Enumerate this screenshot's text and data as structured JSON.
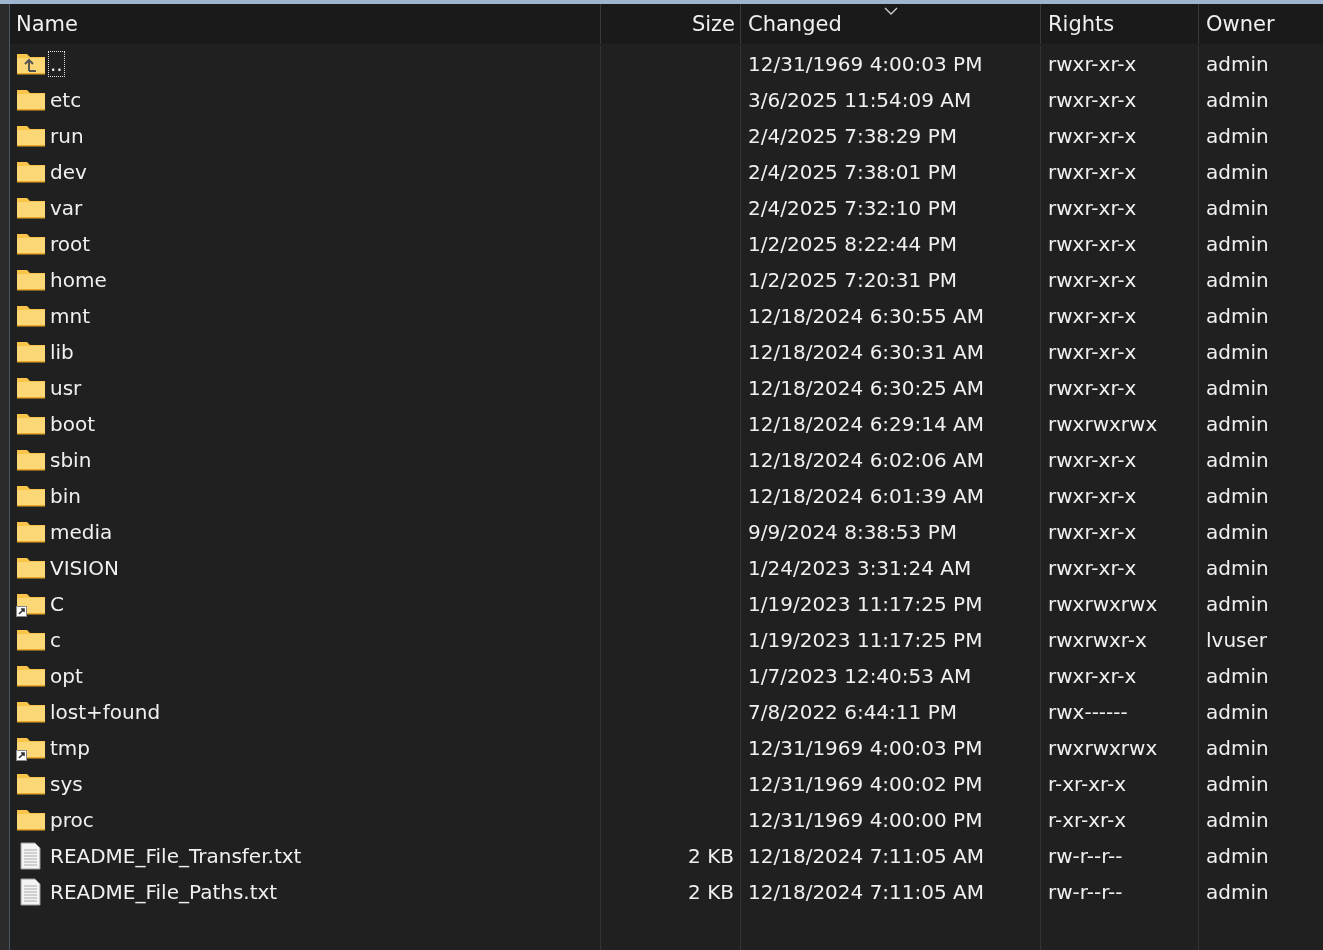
{
  "columns": [
    {
      "label": "Name",
      "sorted": false
    },
    {
      "label": "Size",
      "sorted": false
    },
    {
      "label": "Changed",
      "sorted": true
    },
    {
      "label": "Rights",
      "sorted": false
    },
    {
      "label": "Owner",
      "sorted": false
    }
  ],
  "rows": [
    {
      "kind": "up",
      "name": "..",
      "size": "",
      "changed": "12/31/1969 4:00:03 PM",
      "rights": "rwxr-xr-x",
      "owner": "admin",
      "focused": true
    },
    {
      "kind": "folder",
      "name": "etc",
      "changed": "3/6/2025 11:54:09 AM",
      "rights": "rwxr-xr-x",
      "owner": "admin",
      "focused": false
    },
    {
      "kind": "folder",
      "name": "run",
      "changed": "2/4/2025 7:38:29 PM",
      "rights": "rwxr-xr-x",
      "owner": "admin",
      "focused": false
    },
    {
      "kind": "folder",
      "name": "dev",
      "changed": "2/4/2025 7:38:01 PM",
      "rights": "rwxr-xr-x",
      "owner": "admin",
      "focused": false
    },
    {
      "kind": "folder",
      "name": "var",
      "changed": "2/4/2025 7:32:10 PM",
      "rights": "rwxr-xr-x",
      "owner": "admin",
      "focused": false
    },
    {
      "kind": "folder",
      "name": "root",
      "changed": "1/2/2025 8:22:44 PM",
      "rights": "rwxr-xr-x",
      "owner": "admin",
      "focused": false
    },
    {
      "kind": "folder",
      "name": "home",
      "changed": "1/2/2025 7:20:31 PM",
      "rights": "rwxr-xr-x",
      "owner": "admin",
      "focused": false
    },
    {
      "kind": "folder",
      "name": "mnt",
      "changed": "12/18/2024 6:30:55 AM",
      "rights": "rwxr-xr-x",
      "owner": "admin",
      "focused": false
    },
    {
      "kind": "folder",
      "name": "lib",
      "changed": "12/18/2024 6:30:31 AM",
      "rights": "rwxr-xr-x",
      "owner": "admin",
      "focused": false
    },
    {
      "kind": "folder",
      "name": "usr",
      "changed": "12/18/2024 6:30:25 AM",
      "rights": "rwxr-xr-x",
      "owner": "admin",
      "focused": false
    },
    {
      "kind": "folder",
      "name": "boot",
      "changed": "12/18/2024 6:29:14 AM",
      "rights": "rwxrwxrwx",
      "owner": "admin",
      "focused": false
    },
    {
      "kind": "folder",
      "name": "sbin",
      "changed": "12/18/2024 6:02:06 AM",
      "rights": "rwxr-xr-x",
      "owner": "admin",
      "focused": false
    },
    {
      "kind": "folder",
      "name": "bin",
      "changed": "12/18/2024 6:01:39 AM",
      "rights": "rwxr-xr-x",
      "owner": "admin",
      "focused": false
    },
    {
      "kind": "folder",
      "name": "media",
      "changed": "9/9/2024 8:38:53 PM",
      "rights": "rwxr-xr-x",
      "owner": "admin",
      "focused": false
    },
    {
      "kind": "folder",
      "name": "VISION",
      "changed": "1/24/2023 3:31:24 AM",
      "rights": "rwxr-xr-x",
      "owner": "admin",
      "focused": false
    },
    {
      "kind": "link",
      "name": "C",
      "changed": "1/19/2023 11:17:25 PM",
      "rights": "rwxrwxrwx",
      "owner": "admin",
      "focused": false
    },
    {
      "kind": "folder",
      "name": "c",
      "changed": "1/19/2023 11:17:25 PM",
      "rights": "rwxrwxr-x",
      "owner": "lvuser",
      "focused": false
    },
    {
      "kind": "folder",
      "name": "opt",
      "changed": "1/7/2023 12:40:53 AM",
      "rights": "rwxr-xr-x",
      "owner": "admin",
      "focused": false
    },
    {
      "kind": "folder",
      "name": "lost+found",
      "changed": "7/8/2022 6:44:11 PM",
      "rights": "rwx------",
      "owner": "admin",
      "focused": false
    },
    {
      "kind": "link",
      "name": "tmp",
      "changed": "12/31/1969 4:00:03 PM",
      "rights": "rwxrwxrwx",
      "owner": "admin",
      "focused": false
    },
    {
      "kind": "folder",
      "name": "sys",
      "changed": "12/31/1969 4:00:02 PM",
      "rights": "r-xr-xr-x",
      "owner": "admin",
      "focused": false
    },
    {
      "kind": "folder",
      "name": "proc",
      "changed": "12/31/1969 4:00:00 PM",
      "rights": "r-xr-xr-x",
      "owner": "admin",
      "focused": false
    },
    {
      "kind": "file",
      "name": "README_File_Transfer.txt",
      "size": "2 KB",
      "changed": "12/18/2024 7:11:05 AM",
      "rights": "rw-r--r--",
      "owner": "admin",
      "focused": false
    },
    {
      "kind": "file",
      "name": "README_File_Paths.txt",
      "size": "2 KB",
      "changed": "12/18/2024 7:11:05 AM",
      "rights": "rw-r--r--",
      "owner": "admin",
      "focused": false
    }
  ]
}
